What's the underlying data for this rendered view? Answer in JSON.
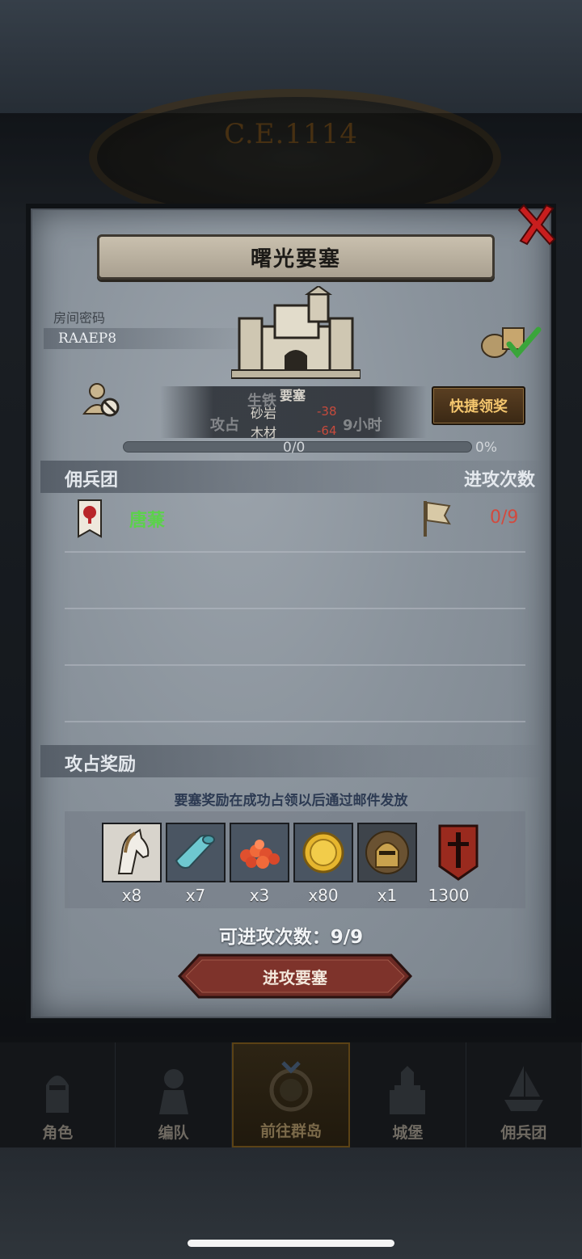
{
  "background": {
    "year_label": "C.E.1114"
  },
  "bottom_nav": {
    "items": [
      {
        "label": "角色",
        "icon": "knight-helmet-icon"
      },
      {
        "label": "编队",
        "icon": "armored-knight-icon"
      },
      {
        "label": "前往群岛",
        "icon": "globe-compass-icon",
        "active": true
      },
      {
        "label": "城堡",
        "icon": "castle-icon"
      },
      {
        "label": "佣兵团",
        "icon": "ship-icon"
      }
    ]
  },
  "dialog": {
    "title": "曙光要塞",
    "room_password_label": "房间密码",
    "room_password": "RAAEP8",
    "fortress": {
      "name": "要塞",
      "resources": [
        {
          "name": "砂岩",
          "value": "-38"
        },
        {
          "name": "木材",
          "value": "-64"
        }
      ],
      "ghost_text_1": "生铁",
      "ghost_text_2": "攻占",
      "ghost_text_3": "9小时"
    },
    "quick_claim_label": "快捷领奖",
    "progress": {
      "text": "0/0",
      "percent_label": "0%",
      "fraction": 0
    },
    "mercenary_section": {
      "left_header": "佣兵团",
      "right_header": "进攻次数",
      "rows": [
        {
          "name": "唐蒹",
          "attacks": "0/9"
        }
      ]
    },
    "reward_section": {
      "header": "攻占奖励",
      "note": "要塞奖励在成功占领以后通过邮件发放",
      "items": [
        {
          "icon": "horse-icon",
          "count": "x8"
        },
        {
          "icon": "cloth-roll-icon",
          "count": "x7"
        },
        {
          "icon": "red-gems-icon",
          "count": "x3"
        },
        {
          "icon": "gold-coin-icon",
          "count": "x80"
        },
        {
          "icon": "knight-helmet-icon",
          "count": "x1"
        },
        {
          "icon": "sword-banner-icon",
          "count": "1300"
        }
      ]
    },
    "attack_count_label": "可进攻次数：9/9",
    "attack_button_label": "进攻要塞"
  },
  "colors": {
    "accent_gold": "#f4c66e",
    "merc_name_green": "#5bd24a",
    "attack_red": "#d24a3e",
    "attack_button": "#6b2a24"
  }
}
